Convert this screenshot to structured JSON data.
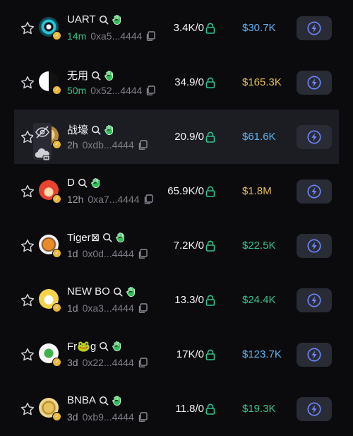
{
  "colors": {
    "age_green": "#2fc48a",
    "mcap_blue": "#5fb3ee",
    "mcap_gold": "#e6bf4a",
    "mcap_green": "#36c58b",
    "button_bg": "#2a2c35",
    "lock_green": "#2fc48a"
  },
  "tokens": [
    {
      "name": "UART",
      "age": "14m",
      "age_color": "green",
      "address": "0xa5...4444",
      "stat": "3.4K/0",
      "mcap": "$30.7K",
      "mcap_color": "blue",
      "avatar": "eye"
    },
    {
      "name": "无用",
      "age": "50m",
      "age_color": "green",
      "address": "0x52...4444",
      "stat": "34.9/0",
      "mcap": "$165.3K",
      "mcap_color": "gold",
      "avatar": "bw"
    },
    {
      "name": "战壕",
      "age": "2h",
      "age_color": "gray",
      "address": "0xdb...4444",
      "stat": "20.9/0",
      "mcap": "$61.6K",
      "mcap_color": "blue",
      "avatar": "gold",
      "highlighted": true
    },
    {
      "name": "D",
      "age": "12h",
      "age_color": "gray",
      "address": "0xa7...4444",
      "stat": "65.9K/0",
      "mcap": "$1.8M",
      "mcap_color": "gold",
      "avatar": "red"
    },
    {
      "name": "Tiger⊠",
      "age": "1d",
      "age_color": "gray",
      "address": "0x0d...4444",
      "stat": "7.2K/0",
      "mcap": "$22.5K",
      "mcap_color": "green",
      "avatar": "tiger"
    },
    {
      "name": "NEW BO",
      "age": "1d",
      "age_color": "gray",
      "address": "0xa3...4444",
      "stat": "13.3/0",
      "mcap": "$24.4K",
      "mcap_color": "green",
      "avatar": "yellow"
    },
    {
      "name": "Fr🐸g",
      "age": "3d",
      "age_color": "gray",
      "address": "0x22...4444",
      "stat": "17K/0",
      "mcap": "$123.7K",
      "mcap_color": "blue",
      "avatar": "frog"
    },
    {
      "name": "BNBA",
      "age": "3d",
      "age_color": "gray",
      "address": "0xb9...4444",
      "stat": "11.8/0",
      "mcap": "$19.3K",
      "mcap_color": "green",
      "avatar": "coin"
    }
  ]
}
